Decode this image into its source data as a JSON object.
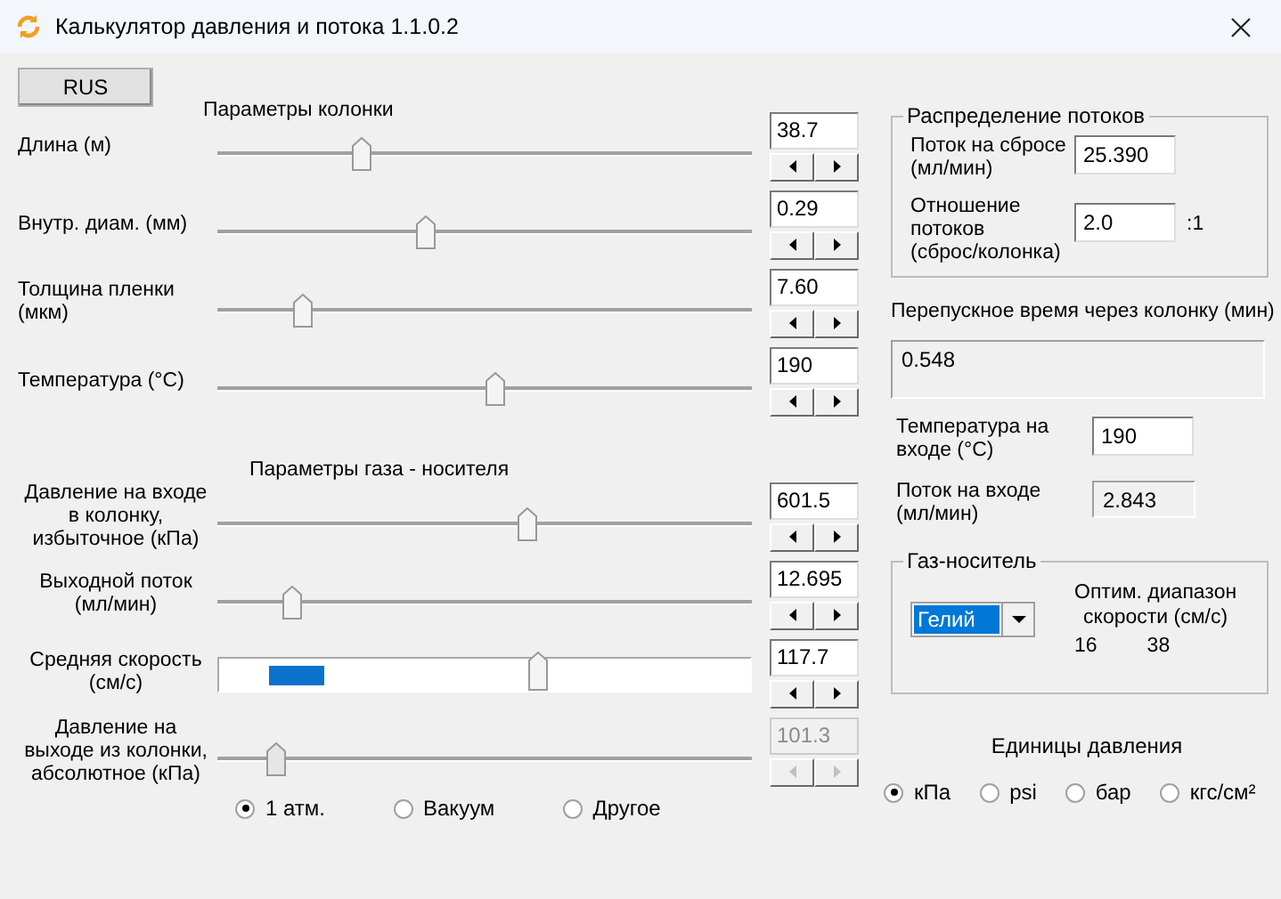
{
  "window": {
    "title": "Калькулятор давления и потока  1.1.0.2"
  },
  "language_button": "RUS",
  "column_section": {
    "title": "Параметры колонки",
    "params": [
      {
        "label": "Длина (м)",
        "kind": "track",
        "level": 0.27,
        "value": "38.7",
        "disabled": false
      },
      {
        "label": "Внутр. диам. (мм)",
        "kind": "track",
        "level": 0.39,
        "value": "0.29",
        "disabled": false
      },
      {
        "label": "Толщина пленки\n(мкм)",
        "kind": "track",
        "level": 0.16,
        "value": "7.60",
        "disabled": false
      },
      {
        "label": "Температура (°C)",
        "kind": "track",
        "level": 0.52,
        "value": "190",
        "disabled": false
      }
    ]
  },
  "gas_section": {
    "title": "Параметры газа - носителя",
    "params": [
      {
        "label": "Давление на входе\nв колонку,\nизбыточное (кПа)",
        "kind": "track",
        "level": 0.58,
        "value": "601.5",
        "disabled": false
      },
      {
        "label": "Выходной поток\n(мл/мин)",
        "kind": "track",
        "level": 0.14,
        "value": "12.695",
        "disabled": false
      },
      {
        "label": "Средняя скорость\n(см/с)",
        "kind": "band",
        "level": 0.6,
        "value": "117.7",
        "disabled": false
      },
      {
        "label": "Давление на\nвыходе из колонки,\nабсолютное (кПа)",
        "kind": "track",
        "level": 0.11,
        "value": "101.3",
        "disabled": true
      }
    ],
    "outlet_options": [
      {
        "label": "1 атм.",
        "selected": true
      },
      {
        "label": "Вакуум",
        "selected": false
      },
      {
        "label": "Другое",
        "selected": false
      }
    ]
  },
  "flow_split": {
    "title": "Распределение потоков",
    "split_flow_label": "Поток на сбросе\n(мл/мин)",
    "split_flow": "25.390",
    "ratio_label": "Отношение\nпотоков\n(сброс/колонка)",
    "ratio": "2.0",
    "ratio_suffix": ":1"
  },
  "holdup": {
    "label": "Перепускное время через колонку (мин)",
    "value": "0.548"
  },
  "inlet_temperature": {
    "label": "Температура на\nвходе (°C)",
    "value": "190"
  },
  "inlet_flow": {
    "label": "Поток на входе\n(мл/мин)",
    "value": "2.843"
  },
  "carrier_gas": {
    "title": "Газ-носитель",
    "gas": "Гелий",
    "range_label": "Оптим. диапазон\nскорости (см/с)",
    "range_min": "16",
    "range_max": "38"
  },
  "pressure_units": {
    "title": "Единицы давления",
    "options": [
      {
        "label": "кПа",
        "selected": true
      },
      {
        "label": "psi",
        "selected": false
      },
      {
        "label": "бар",
        "selected": false
      },
      {
        "label": "кгс/см²",
        "selected": false
      }
    ]
  }
}
